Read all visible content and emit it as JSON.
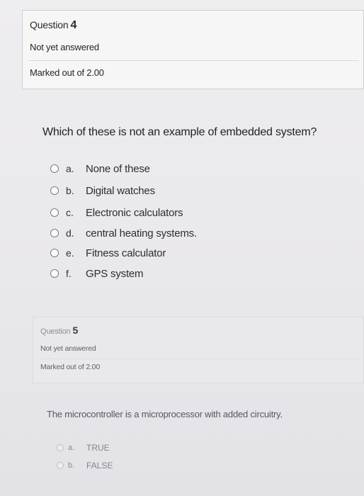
{
  "question4": {
    "label": "Question",
    "number": "4",
    "status": "Not yet answered",
    "marked": "Marked out of 2.00",
    "text": "Which of these is not an example of embedded system?",
    "options": [
      {
        "letter": "a.",
        "text": "None of these"
      },
      {
        "letter": "b.",
        "text": "Digital watches"
      },
      {
        "letter": "c.",
        "text": "Electronic calculators"
      },
      {
        "letter": "d.",
        "text": "central heating systems."
      },
      {
        "letter": "e.",
        "text": "Fitness calculator"
      },
      {
        "letter": "f.",
        "text": "GPS system"
      }
    ]
  },
  "question5": {
    "label": "Question",
    "number": "5",
    "status": "Not yet answered",
    "marked": "Marked out of 2.00",
    "text": "The microcontroller is a microprocessor with added circuitry.",
    "options": [
      {
        "letter": "a.",
        "text": "TRUE"
      },
      {
        "letter": "b.",
        "text": "FALSE"
      }
    ]
  }
}
